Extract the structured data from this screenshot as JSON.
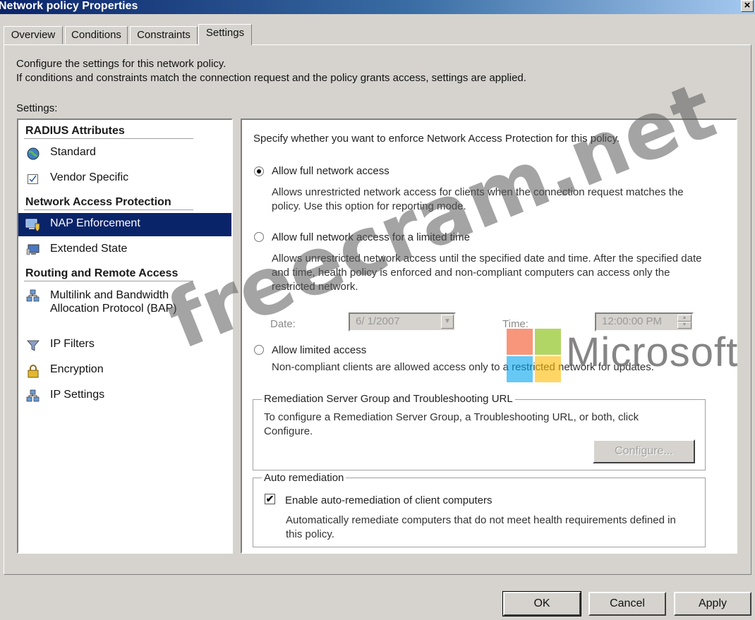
{
  "window": {
    "title": "Network policy Properties",
    "close_glyph": "×"
  },
  "tabs": [
    {
      "label": "Overview"
    },
    {
      "label": "Conditions"
    },
    {
      "label": "Constraints"
    },
    {
      "label": "Settings",
      "active": true
    }
  ],
  "intro": {
    "line1": "Configure the settings for this network policy.",
    "line2": "If conditions and constraints match the connection request and the policy grants access, settings are applied."
  },
  "settings_label": "Settings:",
  "sidebar": {
    "groups": [
      {
        "title": "RADIUS Attributes",
        "items": [
          {
            "label": "Standard",
            "icon": "globe-icon"
          },
          {
            "label": "Vendor Specific",
            "icon": "checkbox-icon"
          }
        ]
      },
      {
        "title": "Network Access Protection",
        "items": [
          {
            "label": "NAP Enforcement",
            "icon": "computer-shield-icon",
            "selected": true
          },
          {
            "label": "Extended State",
            "icon": "monitor-icon"
          }
        ]
      },
      {
        "title": "Routing and Remote Access",
        "items": [
          {
            "label": "Multilink and Bandwidth Allocation Protocol (BAP)",
            "icon": "network-icon"
          },
          {
            "label": "IP Filters",
            "icon": "filter-icon"
          },
          {
            "label": "Encryption",
            "icon": "lock-icon"
          },
          {
            "label": "IP Settings",
            "icon": "network-icon"
          }
        ]
      }
    ]
  },
  "nap": {
    "heading": "Specify whether you want to enforce Network Access Protection for this policy.",
    "options": [
      {
        "label": "Allow full network access",
        "desc": "Allows unrestricted network access for clients when the connection request matches the policy.  Use this option for reporting mode.",
        "selected": true
      },
      {
        "label": "Allow full network access for a limited time",
        "desc": "Allows unrestricted network access until the specified date and time. After the specified date and time, health policy is enforced and non-compliant computers can access only the restricted network.",
        "selected": false
      },
      {
        "label": "Allow limited access",
        "desc": "Non-compliant clients are allowed access only to a restricted network for updates.",
        "selected": false
      }
    ],
    "date_label": "Date:",
    "date_value": "6/ 1/2007",
    "time_label": "Time:",
    "time_value": "12:00:00 PM"
  },
  "remediation": {
    "legend": "Remediation Server Group and Troubleshooting URL",
    "text": "To configure a Remediation Server Group, a Troubleshooting URL, or both, click Configure.",
    "button": "Configure..."
  },
  "auto_remediation": {
    "legend": "Auto remediation",
    "checkbox_label": "Enable auto-remediation of client computers",
    "checked": true,
    "desc": "Automatically remediate computers that do not meet health requirements defined in this policy."
  },
  "buttons": {
    "ok": "OK",
    "cancel": "Cancel",
    "apply": "Apply"
  },
  "watermark": {
    "text": "freecram.net",
    "brand": "Microsoft"
  },
  "colors": {
    "selection": "#0a246a",
    "dialog_bg": "#d6d3ce"
  }
}
